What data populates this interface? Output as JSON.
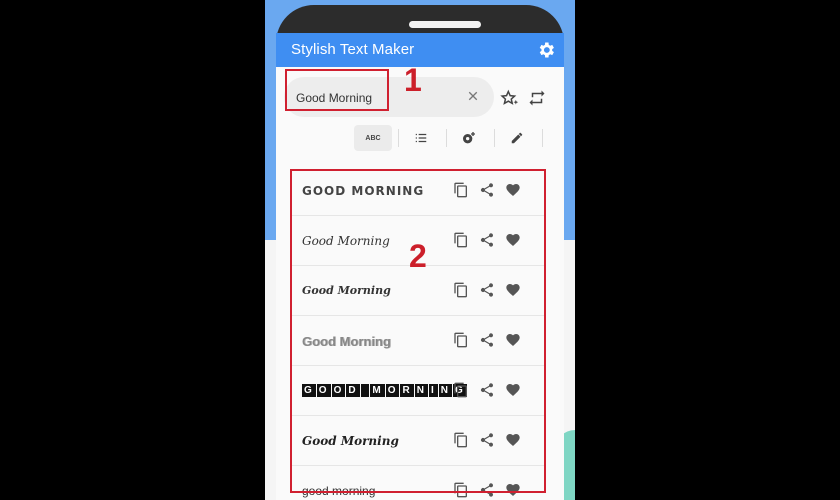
{
  "app": {
    "title": "Stylish Text Maker"
  },
  "input": {
    "value": "Good Morning"
  },
  "tabs": [
    {
      "name": "abc",
      "label": "ABC"
    },
    {
      "name": "list",
      "label": ""
    },
    {
      "name": "settings-plus",
      "label": ""
    },
    {
      "name": "edit",
      "label": ""
    }
  ],
  "annotations": {
    "marker1": "1",
    "marker2": "2"
  },
  "results": [
    {
      "style": "GOOD MORNING"
    },
    {
      "style": "Good Morning"
    },
    {
      "style": "Good Morning"
    },
    {
      "style": "Good Morning"
    },
    {
      "style": "GOOD MORNING"
    },
    {
      "style": "Good Morning"
    },
    {
      "style": "good morning"
    }
  ],
  "colors": {
    "appbar": "#3f8ef2",
    "annotation": "#d02030"
  }
}
